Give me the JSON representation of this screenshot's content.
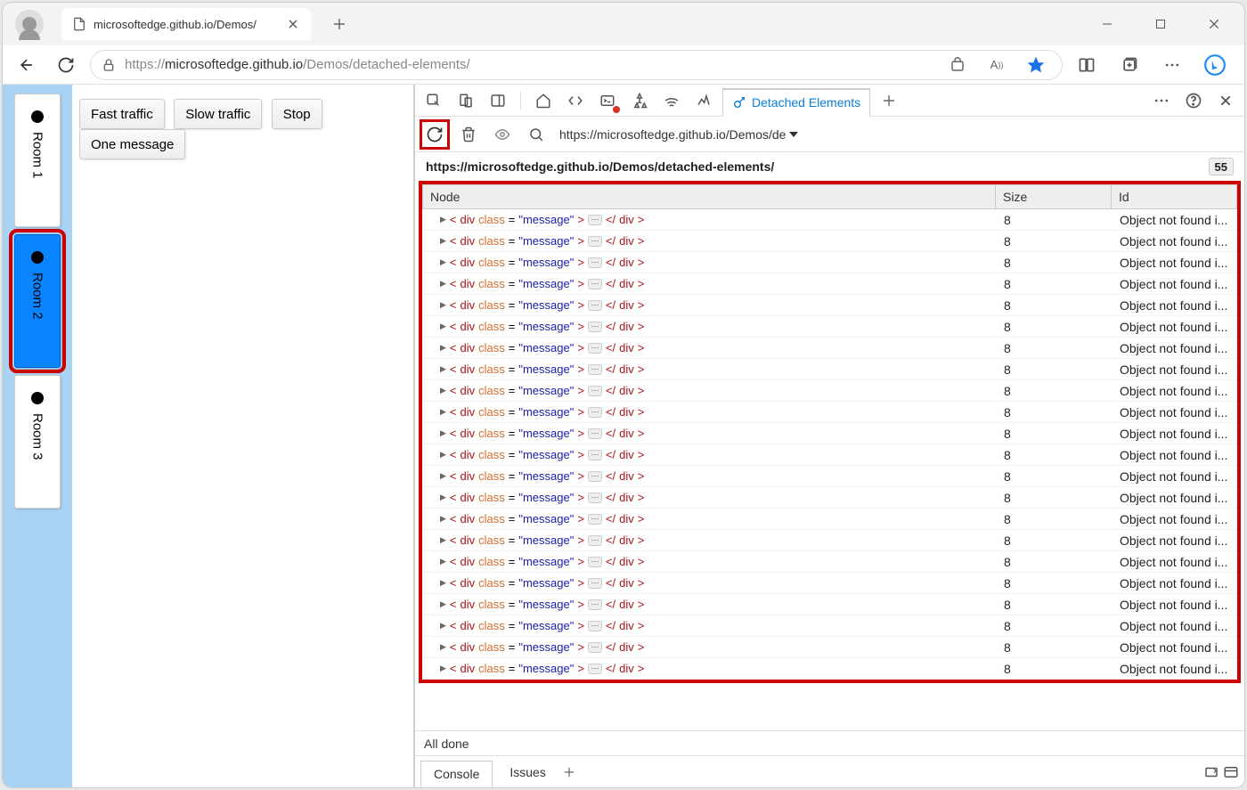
{
  "browser": {
    "tab_title": "microsoftedge.github.io/Demos/",
    "url_display_prefix": "https://",
    "url_display_domain": "microsoftedge.github.io",
    "url_display_path": "/Demos/detached-elements/"
  },
  "page": {
    "rooms": [
      {
        "label": "Room 1",
        "selected": false,
        "highlighted": false
      },
      {
        "label": "Room 2",
        "selected": true,
        "highlighted": true
      },
      {
        "label": "Room 3",
        "selected": false,
        "highlighted": false
      }
    ],
    "buttons": {
      "fast": "Fast traffic",
      "slow": "Slow traffic",
      "stop": "Stop",
      "one": "One message"
    }
  },
  "devtools": {
    "active_tab": "Detached Elements",
    "source_dropdown": "https://microsoftedge.github.io/Demos/de",
    "group_url": "https://microsoftedge.github.io/Demos/detached-elements/",
    "group_count": "55",
    "columns": {
      "node": "Node",
      "size": "Size",
      "id": "Id"
    },
    "row_node_html": "<div class=\"message\">…</div>",
    "row_size": "8",
    "row_id": "Object not found i...",
    "row_count": 22,
    "status": "All done",
    "drawer": {
      "console": "Console",
      "issues": "Issues"
    }
  }
}
